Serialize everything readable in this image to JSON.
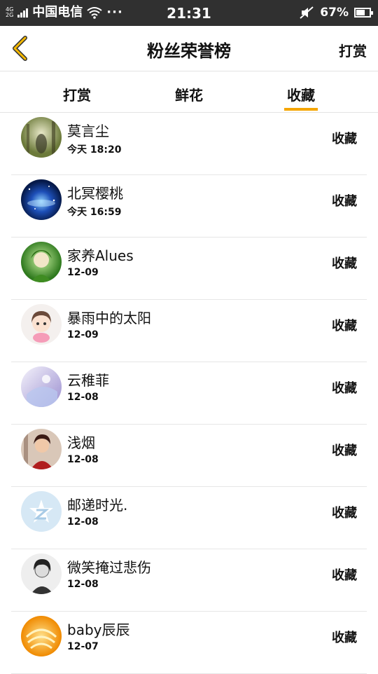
{
  "status_bar": {
    "network_top": "4G",
    "network_bottom": "2G",
    "carrier": "中国电信",
    "more": "···",
    "time": "21:31",
    "battery": "67%",
    "battery_level": 0.67
  },
  "header": {
    "title": "粉丝荣誉榜",
    "action_label": "打赏"
  },
  "tabs": [
    {
      "label": "打赏"
    },
    {
      "label": "鲜花"
    },
    {
      "label": "收藏"
    }
  ],
  "active_tab": 2,
  "accent_color": "#f5a600",
  "list": [
    {
      "name": "莫言尘",
      "time": "今天 18:20",
      "action": "收藏",
      "avatar": "forest"
    },
    {
      "name": "北冥樱桃",
      "time": "今天 16:59",
      "action": "收藏",
      "avatar": "galaxy"
    },
    {
      "name": "家养Alues",
      "time": "12-09",
      "action": "收藏",
      "avatar": "green"
    },
    {
      "name": "暴雨中的太阳",
      "time": "12-09",
      "action": "收藏",
      "avatar": "cartoon"
    },
    {
      "name": "云稚菲",
      "time": "12-08",
      "action": "收藏",
      "avatar": "lilac"
    },
    {
      "name": "浅烟",
      "time": "12-08",
      "action": "收藏",
      "avatar": "portrait"
    },
    {
      "name": "邮递时光.",
      "time": "12-08",
      "action": "收藏",
      "avatar": "default"
    },
    {
      "name": "微笑掩过悲伤",
      "time": "12-08",
      "action": "收藏",
      "avatar": "sketch"
    },
    {
      "name": "baby辰辰",
      "time": "12-07",
      "action": "收藏",
      "avatar": "orange"
    }
  ]
}
